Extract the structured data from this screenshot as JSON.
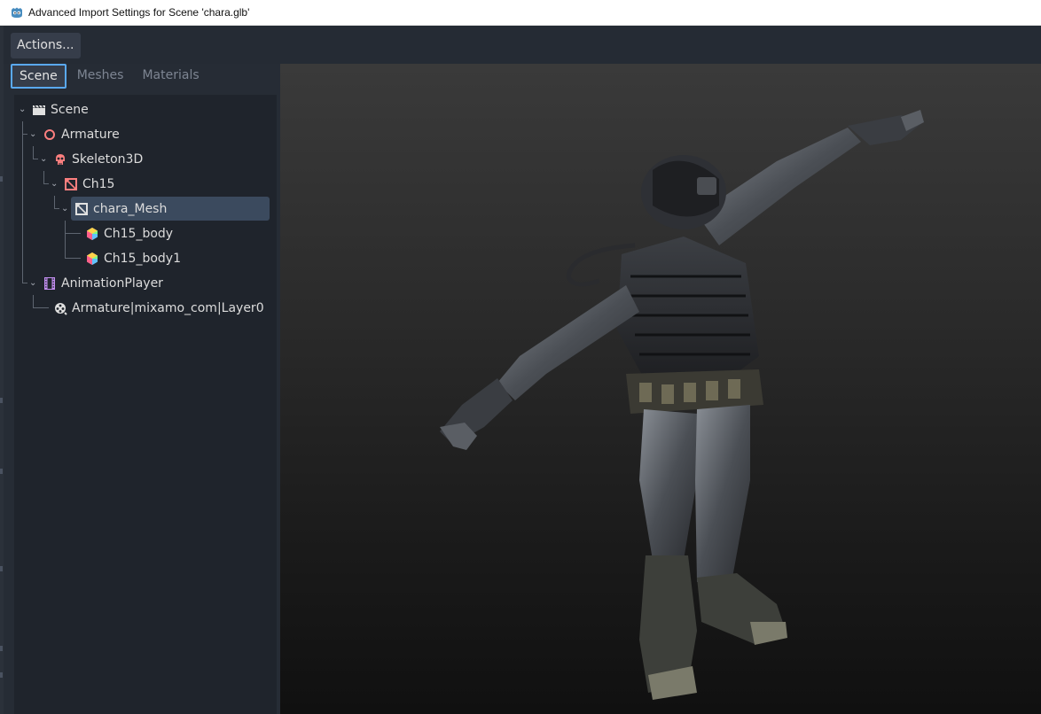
{
  "window": {
    "title": "Advanced Import Settings for Scene 'chara.glb'"
  },
  "toolbar": {
    "actions_label": "Actions..."
  },
  "tabs": [
    {
      "label": "Scene",
      "active": true
    },
    {
      "label": "Meshes",
      "active": false
    },
    {
      "label": "Materials",
      "active": false
    }
  ],
  "tree": {
    "selected": "chara_Mesh",
    "nodes": [
      {
        "label": "Scene",
        "icon": "clapperboard-icon",
        "depth": 0,
        "expanded": true
      },
      {
        "label": "Armature",
        "icon": "node3d-circle-icon",
        "depth": 1,
        "expanded": true
      },
      {
        "label": "Skeleton3D",
        "icon": "skull-icon",
        "depth": 2,
        "expanded": true
      },
      {
        "label": "Ch15",
        "icon": "mesh-instance-icon",
        "depth": 3,
        "expanded": true
      },
      {
        "label": "chara_Mesh",
        "icon": "importer-mesh-icon",
        "depth": 4,
        "expanded": true
      },
      {
        "label": "Ch15_body",
        "icon": "mesh-cube-icon",
        "depth": 5
      },
      {
        "label": "Ch15_body1",
        "icon": "mesh-cube-icon",
        "depth": 5
      },
      {
        "label": "AnimationPlayer",
        "icon": "film-strip-icon",
        "depth": 1,
        "expanded": true
      },
      {
        "label": "Armature|mixamo_com|Layer0",
        "icon": "animation-icon",
        "depth": 2
      }
    ]
  },
  "colors": {
    "accent": "#5aa9f2",
    "selection": "#3b4a5e",
    "node3d": "#fc7f7f",
    "animation": "#c38ef1"
  }
}
